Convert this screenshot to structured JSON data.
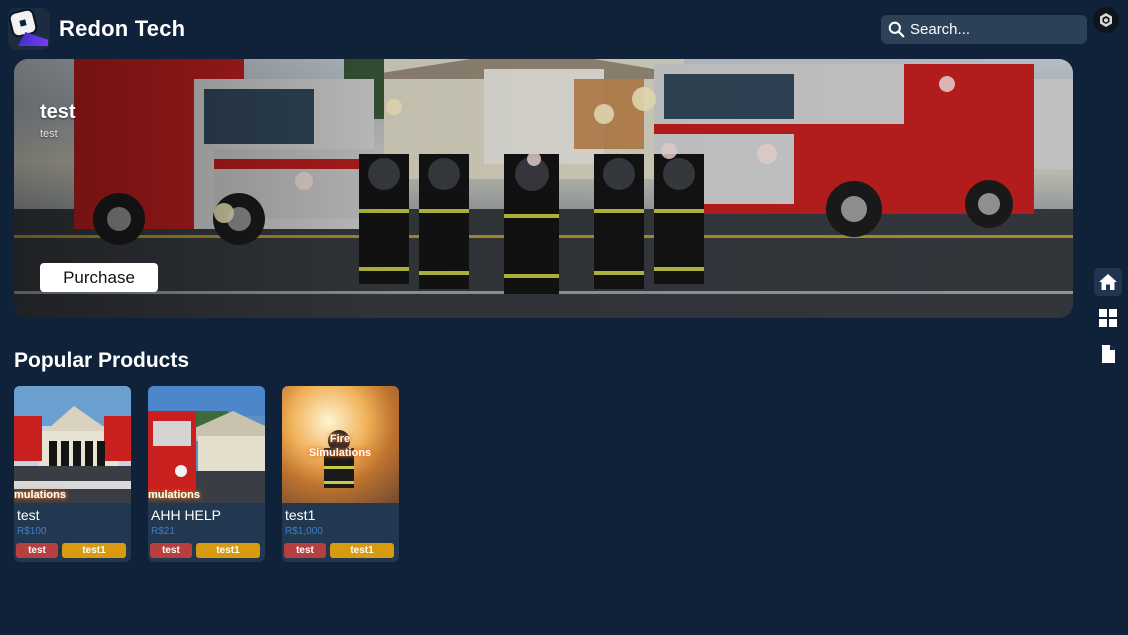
{
  "header": {
    "brand": "Redon Tech",
    "search_placeholder": "Search...",
    "logo_icon": "roblox-logo-icon",
    "avatar_icon": "cube-avatar-icon"
  },
  "banner": {
    "title": "test",
    "subtitle": "test",
    "purchase_label": "Purchase"
  },
  "section": {
    "title": "Popular Products"
  },
  "products": [
    {
      "name": "test",
      "price": "R$100",
      "tags": [
        "test",
        "test1"
      ],
      "thumb_caption": "mulations"
    },
    {
      "name": "AHH HELP",
      "price": "R$21",
      "tags": [
        "test",
        "test1"
      ],
      "thumb_caption": "mulations"
    },
    {
      "name": "test1",
      "price": "R$1,000",
      "tags": [
        "test",
        "test1"
      ],
      "thumb_caption": "Fire Simulations"
    }
  ],
  "rail": {
    "items": [
      {
        "icon": "home-icon",
        "active": true
      },
      {
        "icon": "grid-icon",
        "active": false
      },
      {
        "icon": "document-icon",
        "active": false
      }
    ]
  },
  "colors": {
    "background": "#10223a",
    "card": "#223850",
    "search": "#2c4058",
    "price": "#3f7fc6",
    "tag_red": "#b83f3f",
    "tag_gold": "#d89b10"
  }
}
